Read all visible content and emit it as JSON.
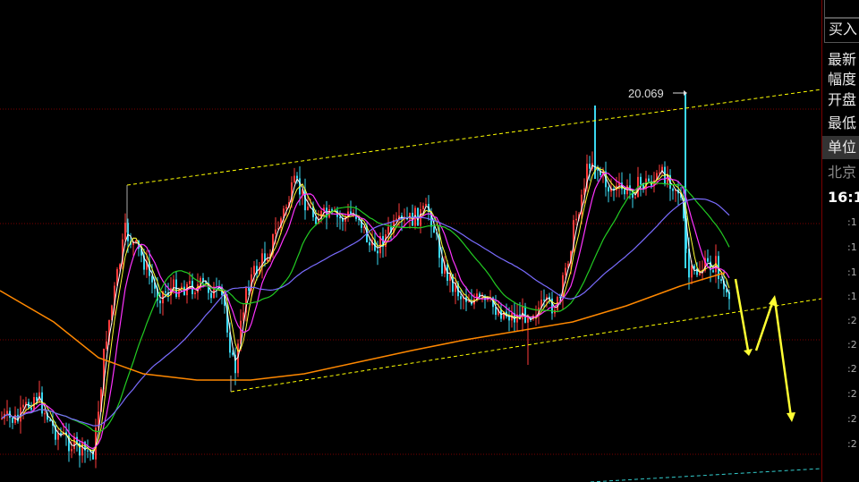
{
  "chart_data": {
    "type": "candlestick",
    "annotations": {
      "high_label": "20.069"
    },
    "hlines": 6,
    "candles_note": "",
    "colors": {
      "up": "#ff3b3b",
      "down": "#3ad7f0",
      "ma5": "#ffffff",
      "ma10": "#ffff33",
      "ma20": "#ff33ff",
      "ma60": "#22cc22",
      "ma120": "#7a6cff",
      "ma250": "#ff8800",
      "trend": "#ffff00",
      "grid": "#7a0000"
    }
  },
  "sidebar": {
    "items": [
      "买入",
      "最新",
      "幅度",
      "开盘",
      "最低",
      "单位",
      "北京",
      "16:1"
    ],
    "ticks": [
      ":1",
      ":1",
      ":1",
      ":1",
      ":2",
      ":2",
      ":2",
      ":2",
      ":2",
      ":2"
    ]
  }
}
